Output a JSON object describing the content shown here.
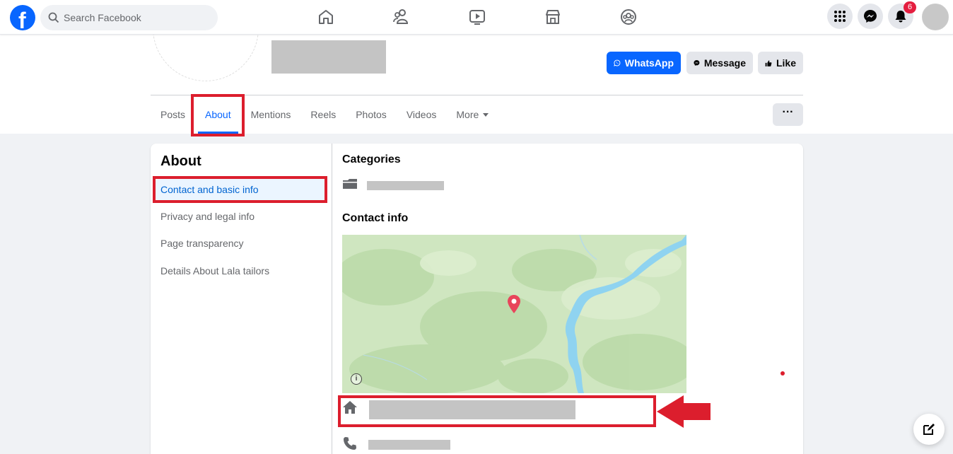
{
  "topbar": {
    "logo": "f",
    "search_placeholder": "Search Facebook",
    "nav_icons": [
      "home-icon",
      "friends-icon",
      "watch-icon",
      "marketplace-icon",
      "groups-icon"
    ],
    "notification_count": "6"
  },
  "profile": {
    "buttons": {
      "whatsapp": "WhatsApp",
      "message": "Message",
      "like": "Like"
    },
    "tabs": [
      "Posts",
      "About",
      "Mentions",
      "Reels",
      "Photos",
      "Videos",
      "More"
    ],
    "active_tab": "About",
    "more_options": "···"
  },
  "about": {
    "title": "About",
    "sidebar": [
      "Contact and basic info",
      "Privacy and legal info",
      "Page transparency",
      "Details About Lala tailors"
    ],
    "active_item": "Contact and basic info",
    "categories_title": "Categories",
    "contact_title": "Contact info",
    "map_info": "i"
  },
  "colors": {
    "brand": "#0866ff",
    "highlight": "#dc1e2d",
    "map_land": "#cfe6c0",
    "map_water": "#8fd3f0"
  }
}
